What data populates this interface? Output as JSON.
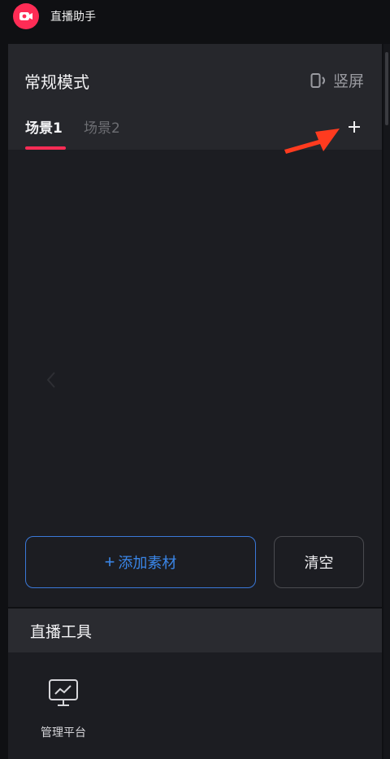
{
  "app": {
    "title": "直播助手",
    "logo_icon": "camera-icon"
  },
  "panel": {
    "mode_title": "常规模式",
    "orientation_label": "竖屏",
    "tabs": [
      {
        "label": "场景1",
        "active": true
      },
      {
        "label": "场景2",
        "active": false
      }
    ],
    "add_scene_icon": "plus-icon",
    "add_material_label": "添加素材",
    "clear_label": "清空"
  },
  "tools": {
    "title": "直播工具",
    "items": [
      {
        "label": "管理平台",
        "icon": "monitor-chart-icon"
      }
    ]
  },
  "colors": {
    "accent": "#fe2c55",
    "primary_blue": "#3a86e8",
    "annotation_arrow": "#ff3b1f"
  }
}
